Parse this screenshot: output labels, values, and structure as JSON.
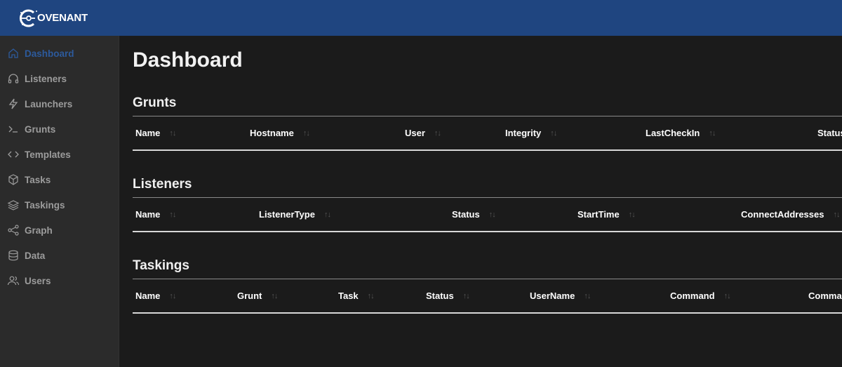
{
  "app": {
    "logo_text": "OVENANT"
  },
  "sidebar": {
    "items": [
      {
        "label": "Dashboard",
        "icon": "home-icon",
        "active": true
      },
      {
        "label": "Listeners",
        "icon": "headphones-icon",
        "active": false
      },
      {
        "label": "Launchers",
        "icon": "lightning-icon",
        "active": false
      },
      {
        "label": "Grunts",
        "icon": "terminal-icon",
        "active": false
      },
      {
        "label": "Templates",
        "icon": "code-icon",
        "active": false
      },
      {
        "label": "Tasks",
        "icon": "cube-icon",
        "active": false
      },
      {
        "label": "Taskings",
        "icon": "layers-icon",
        "active": false
      },
      {
        "label": "Graph",
        "icon": "share-icon",
        "active": false
      },
      {
        "label": "Data",
        "icon": "database-icon",
        "active": false
      },
      {
        "label": "Users",
        "icon": "users-icon",
        "active": false
      }
    ]
  },
  "main": {
    "title": "Dashboard",
    "sections": [
      {
        "title": "Grunts",
        "columns": [
          "Name",
          "Hostname",
          "User",
          "Integrity",
          "LastCheckIn",
          "Status"
        ]
      },
      {
        "title": "Listeners",
        "columns": [
          "Name",
          "ListenerType",
          "Status",
          "StartTime",
          "ConnectAddresses"
        ]
      },
      {
        "title": "Taskings",
        "columns": [
          "Name",
          "Grunt",
          "Task",
          "Status",
          "UserName",
          "Command",
          "Command"
        ]
      }
    ]
  },
  "sort_glyph": "↑↓",
  "colors": {
    "header": "#1f4580",
    "sidebar": "#2b2b2b",
    "content": "#1b1b1b",
    "active_nav": "#2c5a9c"
  }
}
